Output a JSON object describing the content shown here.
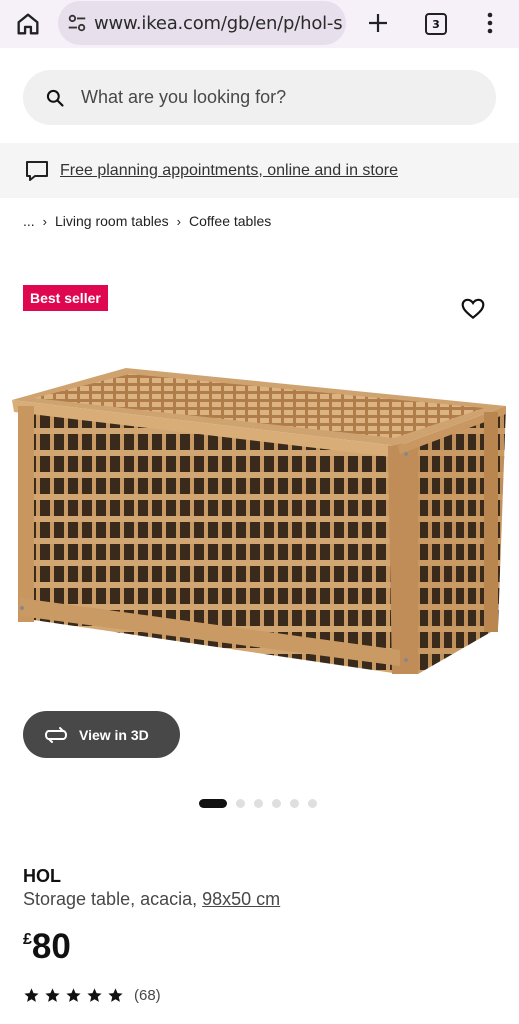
{
  "browser": {
    "url": "www.ikea.com/gb/en/p/hol-s",
    "tab_count": "3"
  },
  "search": {
    "placeholder": "What are you looking for?"
  },
  "banner": {
    "text": "Free planning appointments, online and in store"
  },
  "breadcrumb": {
    "ellipsis": "...",
    "items": [
      "Living room tables",
      "Coffee tables"
    ]
  },
  "product": {
    "badge": "Best seller",
    "view_3d_label": "View in 3D",
    "carousel": {
      "total": 6,
      "active": 1
    },
    "name": "HOL",
    "description": "Storage table, acacia,",
    "size": "98x50 cm",
    "currency": "£",
    "price": "80",
    "rating": 5,
    "review_count": "(68)"
  },
  "colors": {
    "badge": "#e00751",
    "view3d_bg": "#484848"
  }
}
